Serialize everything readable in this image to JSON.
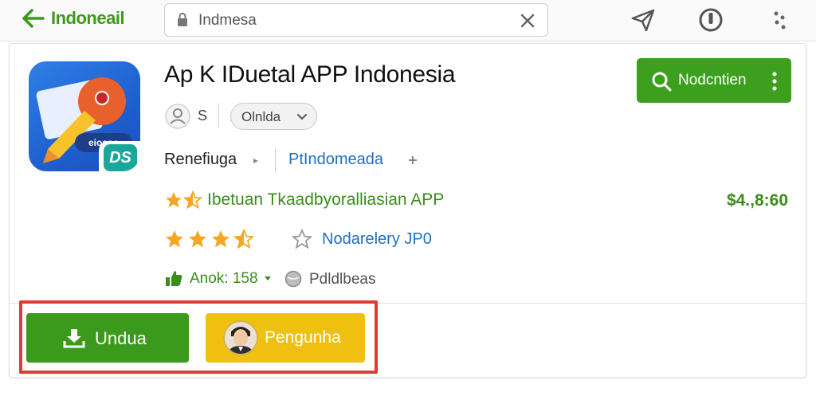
{
  "topbar": {
    "brand": "Indoneail",
    "search_value": "Indmesa"
  },
  "app": {
    "title": "Ap K IDuetal APP Indonesia",
    "icon_badge": "DS",
    "icon_pill": "eiosso",
    "install_label": "Nodcntien",
    "developer_short": "S",
    "category_chip": "Olnlda",
    "row3_left": "Renefiuga",
    "row3_right": "PtIndomeada",
    "tagline": "Ibetuan Tkaadbyoralliasian APP",
    "price": "$4.,8:60",
    "rating_text": "Nodarelery JP0",
    "rating_stars": 3.5,
    "downloads": "Anok: 158",
    "publisher": "Pdldlbeas"
  },
  "actions": {
    "download_label": "Undua",
    "user_label": "Pengunha"
  },
  "colors": {
    "brand_green": "#3d9a1e",
    "link_blue": "#1f6fc1",
    "accent_yellow": "#f0c010",
    "highlight_red": "#e53935"
  }
}
